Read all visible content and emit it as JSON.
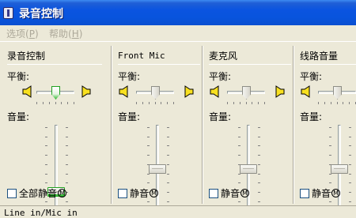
{
  "window": {
    "title": "录音控制"
  },
  "menu": [
    {
      "label": "选项",
      "key": "P"
    },
    {
      "label": "帮助",
      "key": "H"
    }
  ],
  "labels": {
    "balance": "平衡:",
    "volume": "音量:"
  },
  "channels": [
    {
      "name": "录音控制",
      "balance": 0.5,
      "volume": 0.32,
      "checkbox_label": "全部静音",
      "checkbox_key": "M",
      "checked": false,
      "active": true
    },
    {
      "name": "Front Mic",
      "balance": 0.5,
      "volume": 0.58,
      "checkbox_label": "静音",
      "checkbox_key": "M",
      "checked": false,
      "active": false
    },
    {
      "name": "麦克风",
      "balance": 0.5,
      "volume": 0.58,
      "checkbox_label": "静音",
      "checkbox_key": "M",
      "checked": false,
      "active": false
    },
    {
      "name": "线路音量",
      "balance": 0.5,
      "volume": 0.58,
      "checkbox_label": "静音",
      "checkbox_key": "M",
      "checked": false,
      "active": false
    }
  ],
  "status": {
    "text": "Line in/Mic in"
  }
}
